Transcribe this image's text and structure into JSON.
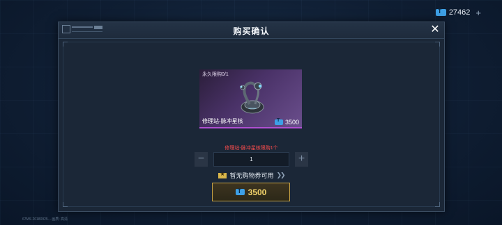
{
  "top_bar": {
    "currency_amount": "27462",
    "plus_symbol": "+"
  },
  "dialog": {
    "title": "购买确认",
    "close_symbol": "✕",
    "item": {
      "limit_label": "永久限购0/1",
      "name": "修理站-脉冲星核",
      "price": "3500"
    },
    "limit_notice": "修理站-脉冲星核限购1个",
    "quantity": {
      "minus": "−",
      "value": "1",
      "plus": "+"
    },
    "coupon": {
      "text": "暂无购物券可用",
      "chevrons": "❯❯"
    },
    "buy_button": {
      "price": "3500"
    }
  },
  "footer": {
    "status": "67MS  20180925... 画质: 高清"
  },
  "colors": {
    "accent_gold": "#c9a445",
    "rarity_purple": "#b04fd2",
    "warning_red": "#ff4d4d",
    "currency_blue": "#3ea0e6"
  }
}
